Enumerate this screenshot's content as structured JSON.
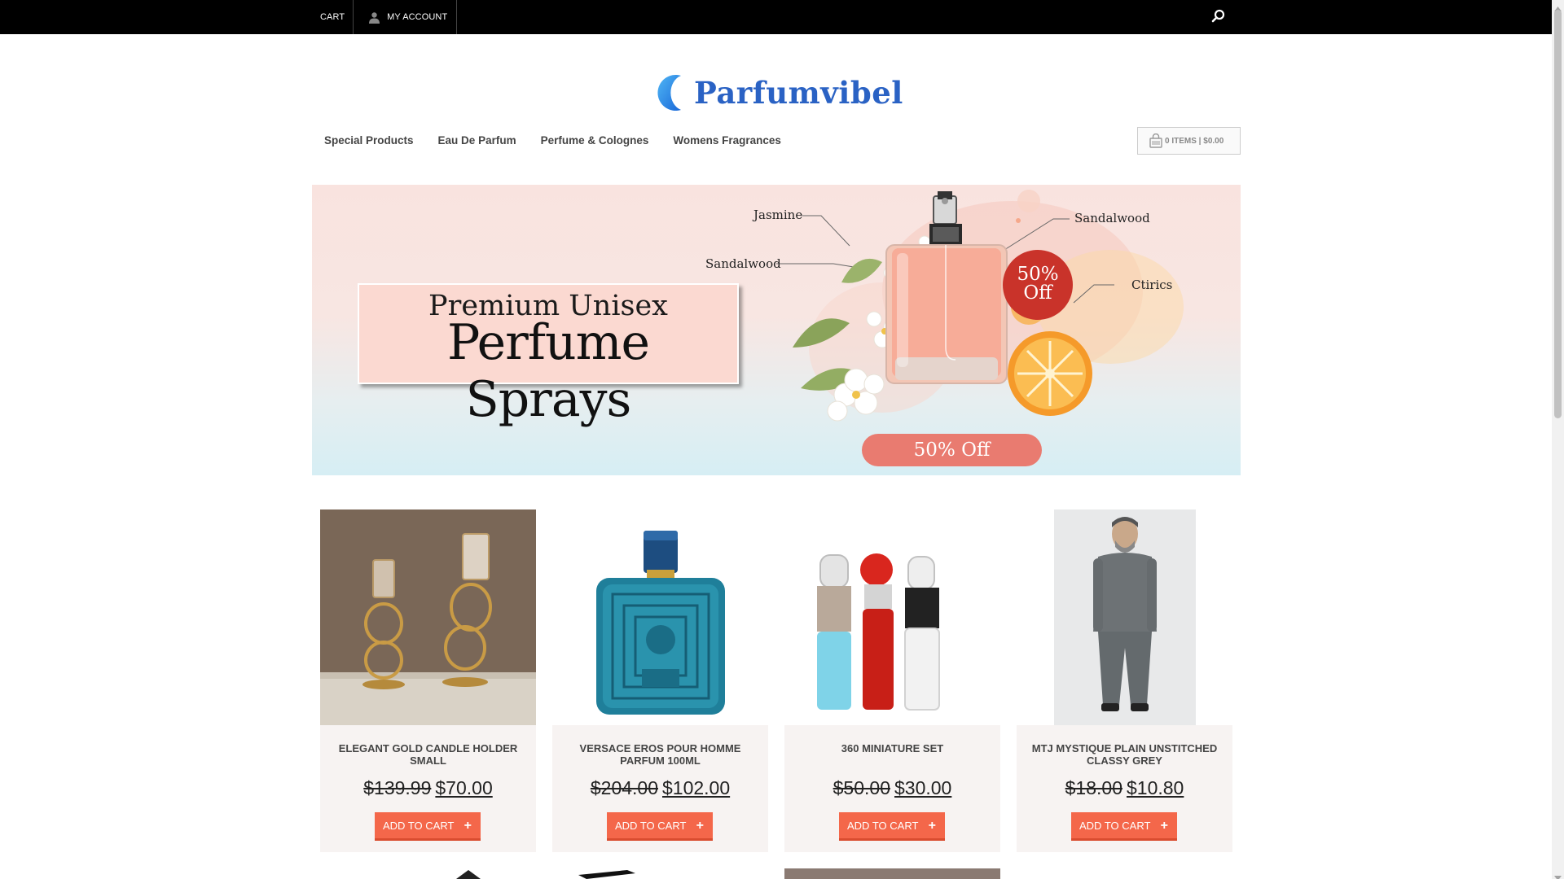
{
  "topbar": {
    "cart_label": "CART",
    "account_label": "MY ACCOUNT"
  },
  "logo": {
    "text": "Parfumvibel",
    "color": "#2a62c4"
  },
  "nav": [
    {
      "label": "Special Products"
    },
    {
      "label": "Eau De Parfum"
    },
    {
      "label": "Perfume & Colognes"
    },
    {
      "label": "Womens Fragrances"
    }
  ],
  "minicart": {
    "text": "0 ITEMS | $0.00"
  },
  "banner": {
    "line1": "Premium Unisex",
    "line2": "Perfume Sprays",
    "notes": [
      "Jasmine",
      "Sandalwood",
      "Sandalwood",
      "Ctirics"
    ],
    "badge_line1": "50%",
    "badge_line2": "Off",
    "pill": "50% Off"
  },
  "products": [
    {
      "name": "ELEGANT GOLD CANDLE HOLDER SMALL",
      "old_price": "$139.99",
      "new_price": "$70.00",
      "button": "ADD TO CART",
      "image": "gold-candle-holders"
    },
    {
      "name": "VERSACE EROS POUR HOMME PARFUM 100ML",
      "old_price": "$204.00",
      "new_price": "$102.00",
      "button": "ADD TO CART",
      "image": "blue-perfume-bottle"
    },
    {
      "name": "360 MINIATURE SET",
      "old_price": "$50.00",
      "new_price": "$30.00",
      "button": "ADD TO CART",
      "image": "three-miniature-bottles"
    },
    {
      "name": "MTJ MYSTIQUE PLAIN UNSTITCHED CLASSY GREY",
      "old_price": "$18.00",
      "new_price": "$10.80",
      "button": "ADD TO CART",
      "image": "man-grey-kurta"
    }
  ],
  "colors": {
    "accent_button": "#f4674a",
    "topbar": "#000000",
    "badge": "#c9332a"
  }
}
